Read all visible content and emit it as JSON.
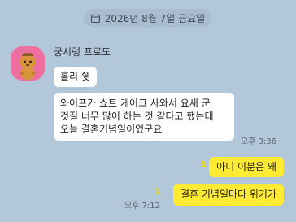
{
  "date_divider": {
    "icon": "calendar-icon",
    "text": "2026년 8월 7일 금요일"
  },
  "sender": {
    "name": "궁시렁 프로도",
    "avatar": "frodo-avatar-icon"
  },
  "messages": [
    {
      "direction": "incoming",
      "text": "홀리 쉣"
    },
    {
      "direction": "incoming",
      "lines": [
        "와이프가 쇼트 케이크 사와서 요새 군",
        "것질 너무 많이 하는 것 같다고 했는데",
        "오늘 결혼기념일이었군요"
      ],
      "time": "오후 3:36"
    },
    {
      "direction": "outgoing",
      "text": "아니 이분은 왜",
      "unread": "1"
    },
    {
      "direction": "outgoing",
      "text": "결혼 기념일마다 위기가",
      "unread": "1",
      "time": "오후 7:12"
    }
  ],
  "colors": {
    "background": "#b2c7d9",
    "incoming_bubble": "#ffffff",
    "outgoing_bubble": "#ffeb33",
    "avatar_bg": "#ec6f9f"
  }
}
